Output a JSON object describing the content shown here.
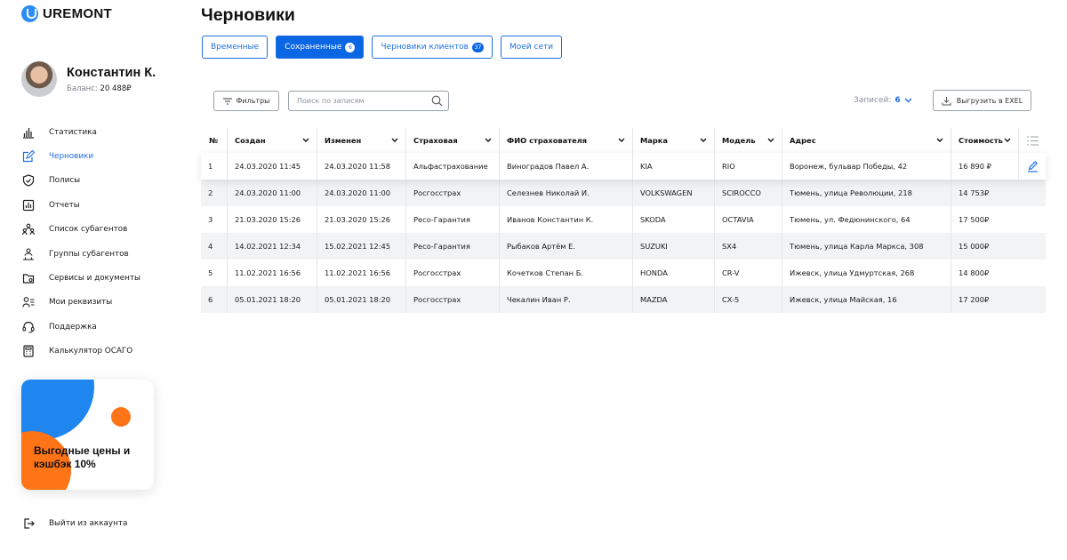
{
  "brand": {
    "name": "UREMONT"
  },
  "user": {
    "name": "Константин К.",
    "balance_label": "Баланс:",
    "balance_value": "20 488₽"
  },
  "nav": [
    {
      "label": "Статистика",
      "icon": "bar-chart-icon",
      "active": false
    },
    {
      "label": "Черновики",
      "icon": "draft-edit-icon",
      "active": true
    },
    {
      "label": "Полисы",
      "icon": "shield-check-icon",
      "active": false
    },
    {
      "label": "Отчеты",
      "icon": "report-chart-icon",
      "active": false
    },
    {
      "label": "Список субагентов",
      "icon": "agents-list-icon",
      "active": false
    },
    {
      "label": "Группы субагентов",
      "icon": "agents-group-icon",
      "active": false
    },
    {
      "label": "Сервисы и документы",
      "icon": "folder-icon",
      "active": false
    },
    {
      "label": "Мои реквизиты",
      "icon": "user-list-icon",
      "active": false
    },
    {
      "label": "Поддержка",
      "icon": "headset-icon",
      "active": false
    },
    {
      "label": "Калькулятор ОСАГО",
      "icon": "calculator-icon",
      "active": false
    }
  ],
  "promo": {
    "text": "Выгодные цены и кэшбэк 10%"
  },
  "logout": {
    "label": "Выйти из аккаунта"
  },
  "page": {
    "title": "Черновики"
  },
  "tabs": [
    {
      "label": "Временные",
      "badge": "",
      "active": false
    },
    {
      "label": "Сохраненные",
      "badge": "6",
      "active": true
    },
    {
      "label": "Черновики клиентов",
      "badge": "37",
      "active": false
    },
    {
      "label": "Моей сети",
      "badge": "",
      "active": false
    }
  ],
  "toolbar": {
    "filters_label": "Фильтры",
    "search_placeholder": "Поиск по записям",
    "records_label": "Записей:",
    "records_value": "6",
    "export_label": "Выгрузить в EXEL"
  },
  "table": {
    "columns": [
      "№",
      "Создан",
      "Изменен",
      "Страховая",
      "ФИО страхователя",
      "Марка",
      "Модель",
      "Адрес",
      "Стоимость"
    ],
    "rows": [
      [
        "1",
        "24.03.2020  11:45",
        "24.03.2020  11:58",
        "Альфастрахование",
        "Виноградов Павел А.",
        "KIA",
        "RIO",
        "Воронеж, бульвар Победы, 42",
        "16 890 ₽"
      ],
      [
        "2",
        "24.03.2020  11:00",
        "24.03.2020  11:00",
        "Росгосстрах",
        "Селезнев Николай И.",
        "VOLKSWAGEN",
        "SCIROCCO",
        "Тюмень, улица Революции, 218",
        "14 753₽"
      ],
      [
        "3",
        "21.03.2020  15:26",
        "21.03.2020  15:26",
        "Ресо-Гарантия",
        "Иванов Константин К.",
        "SKODA",
        "OCTAVIA",
        "Тюмень, ул. Федюнинского, 64",
        "17 500₽"
      ],
      [
        "4",
        "14.02.2021  12:34",
        "15.02.2021  12:45",
        "Ресо-Гарантия",
        "Рыбаков Артём Е.",
        "SUZUKI",
        "SX4",
        "Тюмень, улица Карла Маркса, 308",
        "15 000₽"
      ],
      [
        "5",
        "11.02.2021  16:56",
        "11.02.2021  16:56",
        "Росгосстрах",
        "Кочетков Степан Б.",
        "HONDA",
        "CR-V",
        "Ижевск, улица Удмуртская, 268",
        "14 800₽"
      ],
      [
        "6",
        "05.01.2021  18:20",
        "05.01.2021  18:20",
        "Росгосстрах",
        "Чекалин Иван Р.",
        "MAZDA",
        "CX-5",
        "Ижевск, улица Майская, 16",
        "17 200₽"
      ]
    ]
  },
  "colors": {
    "accent": "#0b66e4",
    "promo_blue": "#1f86f0",
    "promo_orange": "#ff7417"
  }
}
